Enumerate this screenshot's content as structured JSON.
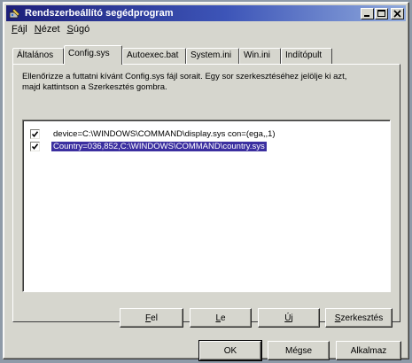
{
  "window": {
    "title": "Rendszerbeállító segédprogram"
  },
  "menu": [
    {
      "first": "F",
      "rest": "ájl"
    },
    {
      "first": "N",
      "rest": "ézet"
    },
    {
      "first": "S",
      "rest": "úgó"
    }
  ],
  "tabs": [
    "Általános",
    "Config.sys",
    "Autoexec.bat",
    "System.ini",
    "Win.ini",
    "Indítópult"
  ],
  "active_tab": "Config.sys",
  "instructions": {
    "line1": "Ellenőrizze a futtatni kívánt Config.sys fájl sorait. Egy sor szerkesztéséhez jelölje ki azt,",
    "line2": "majd kattintson a Szerkesztés gombra."
  },
  "config_lines": [
    {
      "text": "device=C:\\WINDOWS\\COMMAND\\display.sys con=(ega,,1)",
      "checked": true,
      "selected": false
    },
    {
      "text": "Country=036,852,C:\\WINDOWS\\COMMAND\\country.sys",
      "checked": true,
      "selected": true
    }
  ],
  "panel_buttons": {
    "up": {
      "first": "F",
      "rest": "el"
    },
    "down": {
      "first": "L",
      "rest": "e"
    },
    "new": {
      "first": "Ú",
      "rest": "j"
    },
    "edit": {
      "first": "S",
      "rest": "zerkesztés"
    }
  },
  "dialog_buttons": {
    "ok": "OK",
    "cancel": "Mégse",
    "apply": "Alkalmaz"
  },
  "colors": {
    "title_start": "#1d1f7a",
    "title_end": "#8fa9dc",
    "selection": "#3b2fa0",
    "face": "#d6d6ce"
  }
}
